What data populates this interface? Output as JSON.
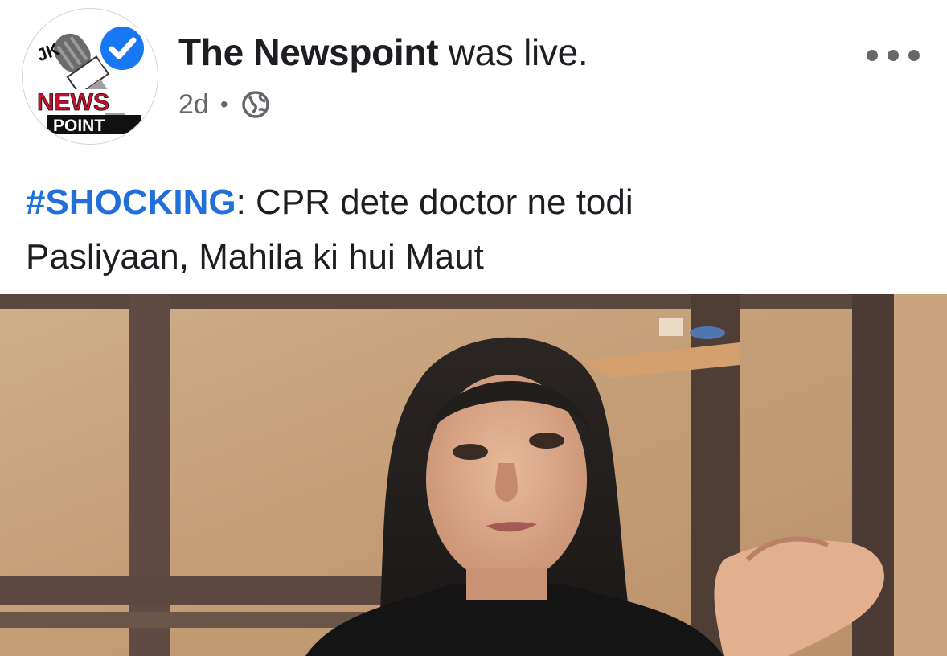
{
  "post": {
    "author": {
      "name": "The Newspoint",
      "action": " was live.",
      "avatar_text_top": "JK",
      "avatar_text_mid": "NEWS",
      "avatar_text_bottom": "POINT",
      "verified_icon": "verified-check-icon"
    },
    "time": "2d",
    "separator": "•",
    "audience_icon": "globe-icon",
    "menu_icon": "more-options-icon",
    "caption": {
      "hashtag": "#SHOCKING",
      "line1_rest": ": CPR dete doctor ne todi",
      "line2": "Pasliyaan, Mahila ki hui Maut"
    },
    "video": {
      "thumbnail_description": "live-video-thumbnail"
    }
  },
  "colors": {
    "hashtag": "#216fdb",
    "verified": "#1877f2",
    "text_primary": "#1c1e21",
    "text_secondary": "#65676b"
  }
}
